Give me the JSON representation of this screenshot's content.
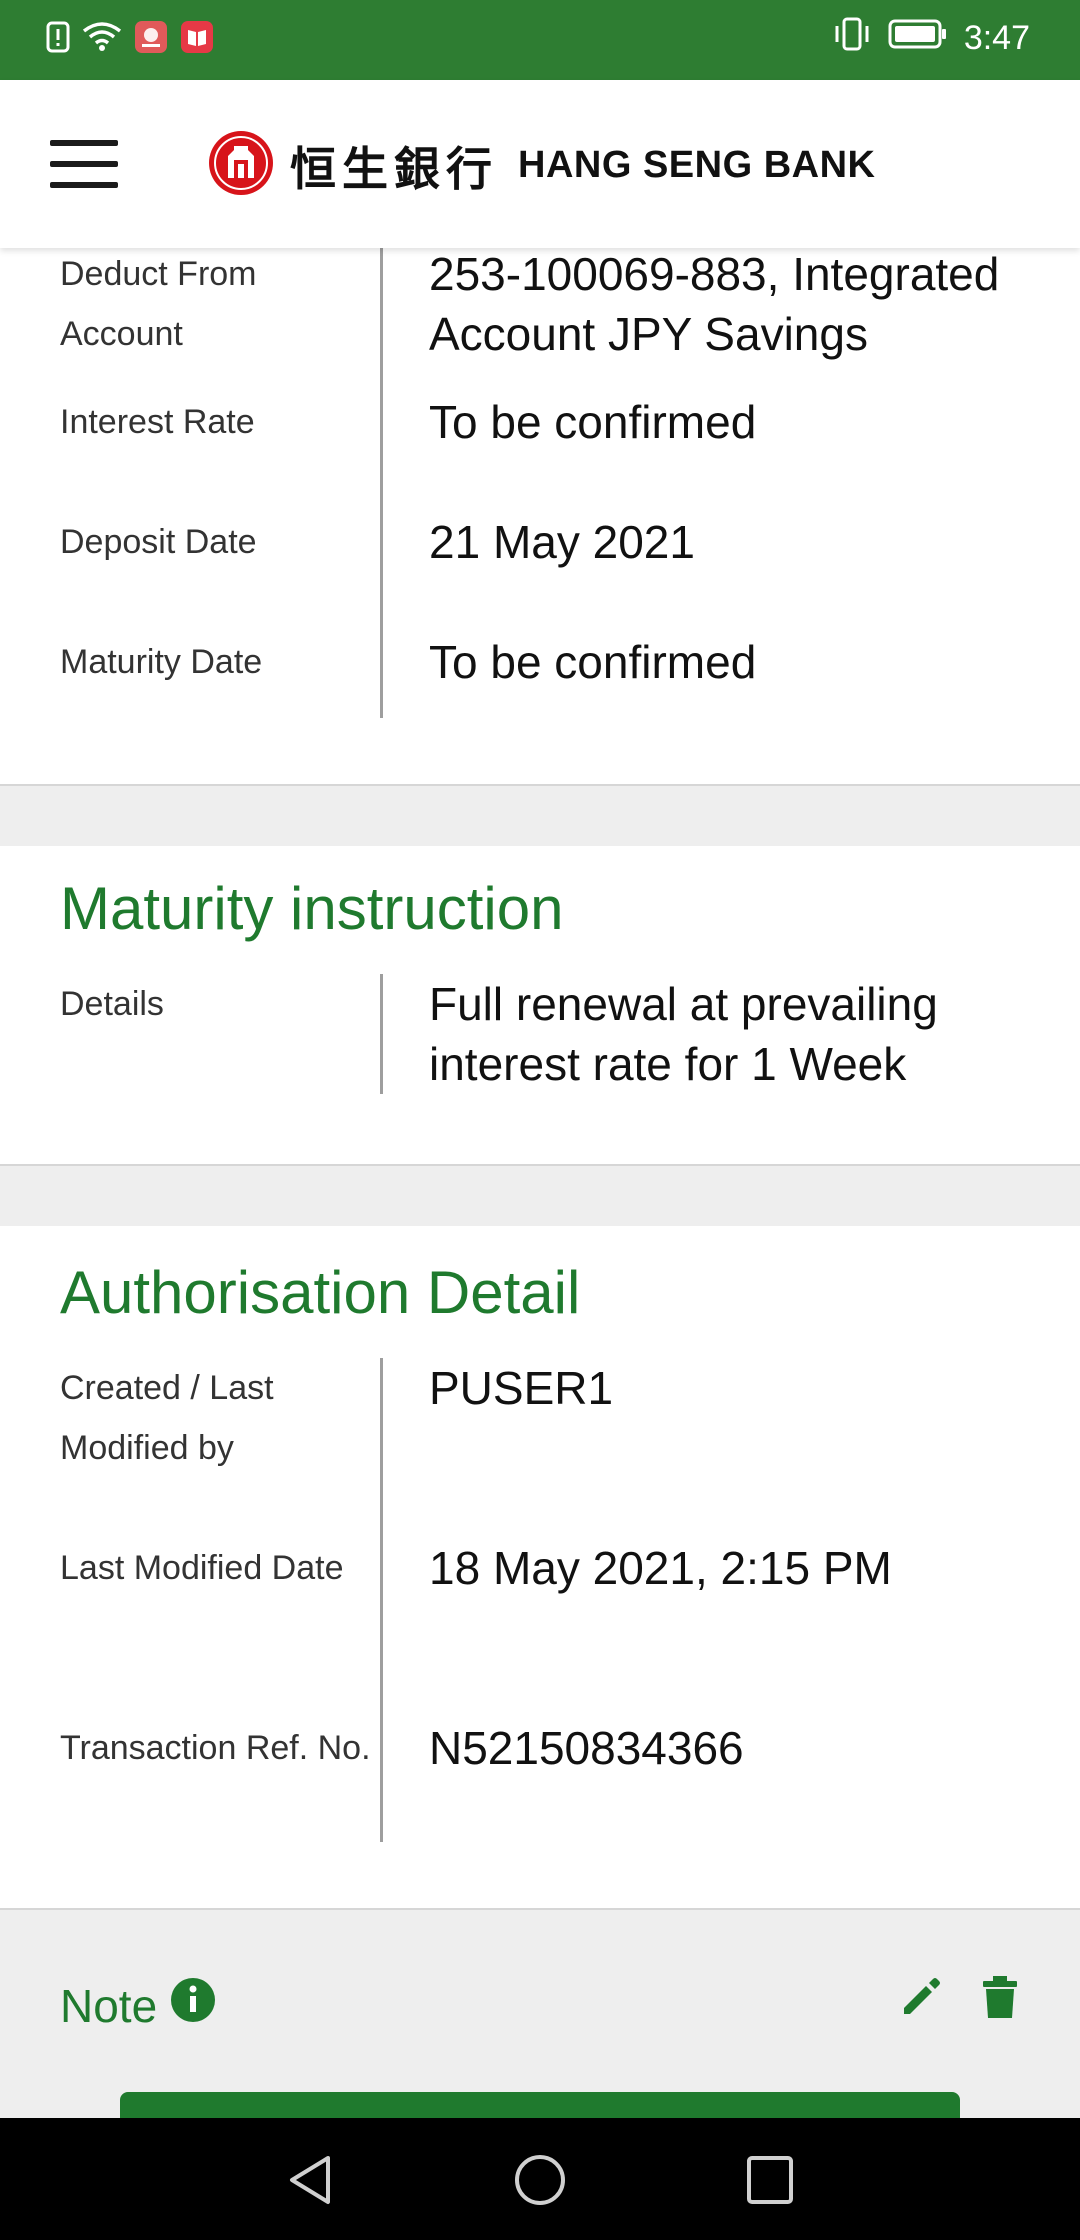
{
  "status_bar": {
    "time": "3:47",
    "icons": [
      "alert-icon",
      "wifi-icon",
      "huawei-app-icon",
      "book-app-icon",
      "vibrate-icon",
      "battery-icon"
    ]
  },
  "app_bar": {
    "brand_chinese": "恒生銀行",
    "brand_english": "HANG SENG BANK"
  },
  "deposit_details": {
    "rows": [
      {
        "label": "Deduct From Account",
        "value": "253-100069-883, Integrated Account JPY Savings"
      },
      {
        "label": "Interest Rate",
        "value": "To be confirmed"
      },
      {
        "label": "Deposit Date",
        "value": "21 May 2021"
      },
      {
        "label": "Maturity Date",
        "value": "To be confirmed"
      }
    ]
  },
  "maturity_instruction": {
    "title": "Maturity instruction",
    "rows": [
      {
        "label": "Details",
        "value": "Full renewal at prevailing interest rate for 1 Week"
      }
    ]
  },
  "authorisation_detail": {
    "title": "Authorisation Detail",
    "rows": [
      {
        "label": "Created / Last Modified by",
        "value": "PUSER1"
      },
      {
        "label": "Last Modified Date",
        "value": "18 May 2021, 2:15 PM"
      },
      {
        "label": "Transaction Ref. No.",
        "value": "N52150834366"
      }
    ]
  },
  "note": {
    "label": "Note",
    "icons": [
      "info-icon",
      "edit-icon",
      "delete-icon"
    ]
  },
  "colors": {
    "status_bar": "#2e7d32",
    "accent_green": "#1f7a2e",
    "logo_red": "#d7141a"
  },
  "nav_bar": {
    "icons": [
      "back-icon",
      "home-icon",
      "recents-icon"
    ]
  }
}
